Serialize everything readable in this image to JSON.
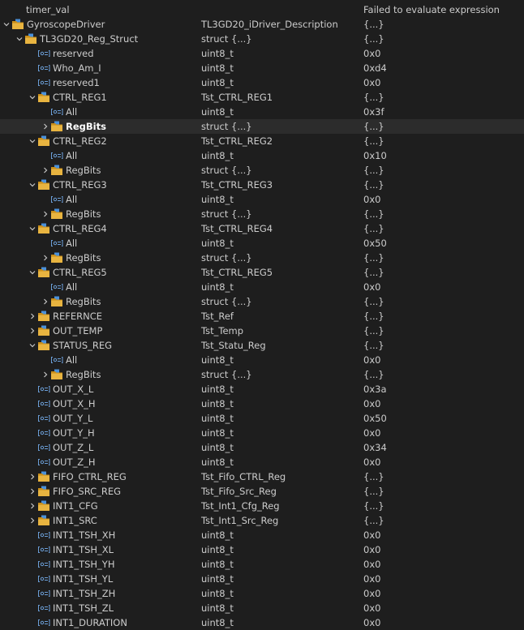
{
  "columns": {
    "divider_colors": "#2d2d2d"
  },
  "rows": [
    {
      "name": "timer_val",
      "type": "",
      "value": "Failed to evaluate expression",
      "level": 0,
      "kind": "none",
      "twisty": "none"
    },
    {
      "name": "GyroscopeDriver",
      "type": "TL3GD20_iDriver_Description",
      "value": "{...}",
      "level": 0,
      "kind": "struct",
      "twisty": "expanded"
    },
    {
      "name": "TL3GD20_Reg_Struct",
      "type": "struct {...}",
      "value": "{...}",
      "level": 1,
      "kind": "struct",
      "twisty": "expanded"
    },
    {
      "name": "reserved",
      "type": "uint8_t",
      "value": "0x0",
      "level": 2,
      "kind": "field",
      "twisty": "none"
    },
    {
      "name": "Who_Am_I",
      "type": "uint8_t",
      "value": "0xd4",
      "level": 2,
      "kind": "field",
      "twisty": "none"
    },
    {
      "name": "reserved1",
      "type": "uint8_t",
      "value": "0x0",
      "level": 2,
      "kind": "field",
      "twisty": "none"
    },
    {
      "name": "CTRL_REG1",
      "type": "Tst_CTRL_REG1",
      "value": "{...}",
      "level": 2,
      "kind": "struct",
      "twisty": "expanded"
    },
    {
      "name": "All",
      "type": "uint8_t",
      "value": "0x3f",
      "level": 3,
      "kind": "field",
      "twisty": "none"
    },
    {
      "name": "RegBits",
      "type": "struct {...}",
      "value": "{...}",
      "level": 3,
      "kind": "struct",
      "twisty": "collapsed",
      "selected": true
    },
    {
      "name": "CTRL_REG2",
      "type": "Tst_CTRL_REG2",
      "value": "{...}",
      "level": 2,
      "kind": "struct",
      "twisty": "expanded"
    },
    {
      "name": "All",
      "type": "uint8_t",
      "value": "0x10",
      "level": 3,
      "kind": "field",
      "twisty": "none"
    },
    {
      "name": "RegBits",
      "type": "struct {...}",
      "value": "{...}",
      "level": 3,
      "kind": "struct",
      "twisty": "collapsed"
    },
    {
      "name": "CTRL_REG3",
      "type": "Tst_CTRL_REG3",
      "value": "{...}",
      "level": 2,
      "kind": "struct",
      "twisty": "expanded"
    },
    {
      "name": "All",
      "type": "uint8_t",
      "value": "0x0",
      "level": 3,
      "kind": "field",
      "twisty": "none"
    },
    {
      "name": "RegBits",
      "type": "struct {...}",
      "value": "{...}",
      "level": 3,
      "kind": "struct",
      "twisty": "collapsed"
    },
    {
      "name": "CTRL_REG4",
      "type": "Tst_CTRL_REG4",
      "value": "{...}",
      "level": 2,
      "kind": "struct",
      "twisty": "expanded"
    },
    {
      "name": "All",
      "type": "uint8_t",
      "value": "0x50",
      "level": 3,
      "kind": "field",
      "twisty": "none"
    },
    {
      "name": "RegBits",
      "type": "struct {...}",
      "value": "{...}",
      "level": 3,
      "kind": "struct",
      "twisty": "collapsed"
    },
    {
      "name": "CTRL_REG5",
      "type": "Tst_CTRL_REG5",
      "value": "{...}",
      "level": 2,
      "kind": "struct",
      "twisty": "expanded"
    },
    {
      "name": "All",
      "type": "uint8_t",
      "value": "0x0",
      "level": 3,
      "kind": "field",
      "twisty": "none"
    },
    {
      "name": "RegBits",
      "type": "struct {...}",
      "value": "{...}",
      "level": 3,
      "kind": "struct",
      "twisty": "collapsed"
    },
    {
      "name": "REFERNCE",
      "type": "Tst_Ref",
      "value": "{...}",
      "level": 2,
      "kind": "struct",
      "twisty": "collapsed"
    },
    {
      "name": "OUT_TEMP",
      "type": "Tst_Temp",
      "value": "{...}",
      "level": 2,
      "kind": "struct",
      "twisty": "collapsed"
    },
    {
      "name": "STATUS_REG",
      "type": "Tst_Statu_Reg",
      "value": "{...}",
      "level": 2,
      "kind": "struct",
      "twisty": "expanded"
    },
    {
      "name": "All",
      "type": "uint8_t",
      "value": "0x0",
      "level": 3,
      "kind": "field",
      "twisty": "none"
    },
    {
      "name": "RegBits",
      "type": "struct {...}",
      "value": "{...}",
      "level": 3,
      "kind": "struct",
      "twisty": "collapsed"
    },
    {
      "name": "OUT_X_L",
      "type": "uint8_t",
      "value": "0x3a",
      "level": 2,
      "kind": "field",
      "twisty": "none"
    },
    {
      "name": "OUT_X_H",
      "type": "uint8_t",
      "value": "0x0",
      "level": 2,
      "kind": "field",
      "twisty": "none"
    },
    {
      "name": "OUT_Y_L",
      "type": "uint8_t",
      "value": "0x50",
      "level": 2,
      "kind": "field",
      "twisty": "none"
    },
    {
      "name": "OUT_Y_H",
      "type": "uint8_t",
      "value": "0x0",
      "level": 2,
      "kind": "field",
      "twisty": "none"
    },
    {
      "name": "OUT_Z_L",
      "type": "uint8_t",
      "value": "0x34",
      "level": 2,
      "kind": "field",
      "twisty": "none"
    },
    {
      "name": "OUT_Z_H",
      "type": "uint8_t",
      "value": "0x0",
      "level": 2,
      "kind": "field",
      "twisty": "none"
    },
    {
      "name": "FIFO_CTRL_REG",
      "type": "Tst_Fifo_CTRL_Reg",
      "value": "{...}",
      "level": 2,
      "kind": "struct",
      "twisty": "collapsed"
    },
    {
      "name": "FIFO_SRC_REG",
      "type": "Tst_Fifo_Src_Reg",
      "value": "{...}",
      "level": 2,
      "kind": "struct",
      "twisty": "collapsed"
    },
    {
      "name": "INT1_CFG",
      "type": "Tst_Int1_Cfg_Reg",
      "value": "{...}",
      "level": 2,
      "kind": "struct",
      "twisty": "collapsed"
    },
    {
      "name": "INT1_SRC",
      "type": "Tst_Int1_Src_Reg",
      "value": "{...}",
      "level": 2,
      "kind": "struct",
      "twisty": "collapsed"
    },
    {
      "name": "INT1_TSH_XH",
      "type": "uint8_t",
      "value": "0x0",
      "level": 2,
      "kind": "field",
      "twisty": "none"
    },
    {
      "name": "INT1_TSH_XL",
      "type": "uint8_t",
      "value": "0x0",
      "level": 2,
      "kind": "field",
      "twisty": "none"
    },
    {
      "name": "INT1_TSH_YH",
      "type": "uint8_t",
      "value": "0x0",
      "level": 2,
      "kind": "field",
      "twisty": "none"
    },
    {
      "name": "INT1_TSH_YL",
      "type": "uint8_t",
      "value": "0x0",
      "level": 2,
      "kind": "field",
      "twisty": "none"
    },
    {
      "name": "INT1_TSH_ZH",
      "type": "uint8_t",
      "value": "0x0",
      "level": 2,
      "kind": "field",
      "twisty": "none"
    },
    {
      "name": "INT1_TSH_ZL",
      "type": "uint8_t",
      "value": "0x0",
      "level": 2,
      "kind": "field",
      "twisty": "none"
    },
    {
      "name": "INT1_DURATION",
      "type": "uint8_t",
      "value": "0x0",
      "level": 2,
      "kind": "field",
      "twisty": "none"
    }
  ],
  "icons": {
    "struct": "struct-folder-icon",
    "field": "variable-field-icon",
    "expanded": "chevron-down-icon",
    "collapsed": "chevron-right-icon"
  },
  "colors": {
    "folder_fill": "#e8b440",
    "folder_edge": "#c98e1a",
    "folder_accent": "#4a90d9",
    "field_icon": "#6c9fd8",
    "selected_row": "#2c2c2c"
  }
}
